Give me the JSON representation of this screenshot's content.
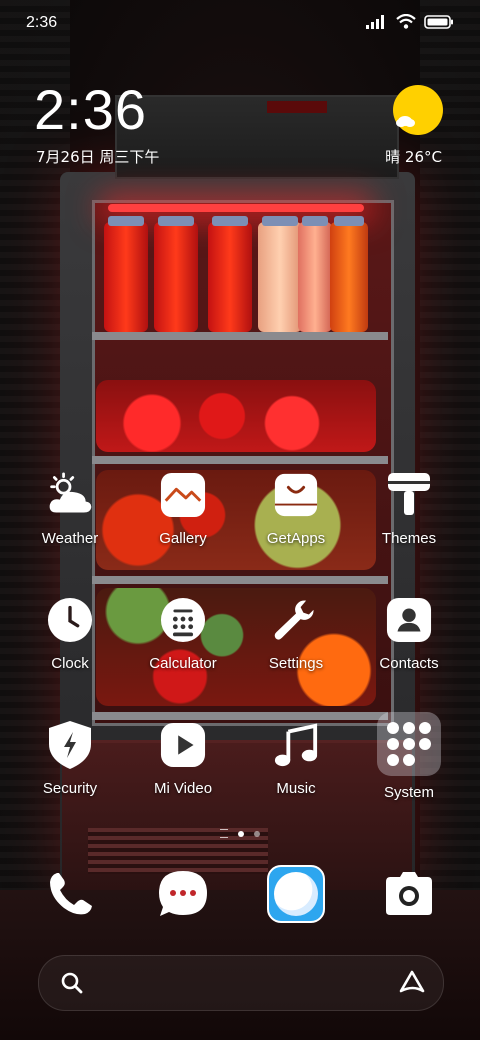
{
  "status_bar": {
    "time": "2:36",
    "icons": [
      "signal-icon",
      "wifi-icon",
      "battery-icon"
    ]
  },
  "clock_widget": {
    "time": "2:36",
    "date": "7月26日 周三下午"
  },
  "weather_widget": {
    "condition_icon": "sun-cloud-icon",
    "text": "晴 26°C"
  },
  "apps": [
    {
      "label": "Weather",
      "icon": "weather-icon"
    },
    {
      "label": "Gallery",
      "icon": "gallery-icon"
    },
    {
      "label": "GetApps",
      "icon": "shopping-bag-icon"
    },
    {
      "label": "Themes",
      "icon": "paint-roller-icon"
    },
    {
      "label": "Clock",
      "icon": "clock-icon"
    },
    {
      "label": "Calculator",
      "icon": "calculator-icon"
    },
    {
      "label": "Settings",
      "icon": "wrench-icon"
    },
    {
      "label": "Contacts",
      "icon": "contact-icon"
    },
    {
      "label": "Security",
      "icon": "shield-icon"
    },
    {
      "label": "Mi Video",
      "icon": "play-icon"
    },
    {
      "label": "Music",
      "icon": "music-note-icon"
    },
    {
      "label": "System",
      "icon": "folder-icon"
    }
  ],
  "page_indicator": {
    "pages": 2,
    "current": 1
  },
  "dock": [
    {
      "name": "phone",
      "icon": "phone-icon"
    },
    {
      "name": "messages",
      "icon": "chat-bubble-icon"
    },
    {
      "name": "browser",
      "icon": "browser-icon"
    },
    {
      "name": "camera",
      "icon": "camera-icon"
    }
  ],
  "search_bar": {
    "left_icon": "search-icon",
    "right_icon": "assistant-icon"
  }
}
